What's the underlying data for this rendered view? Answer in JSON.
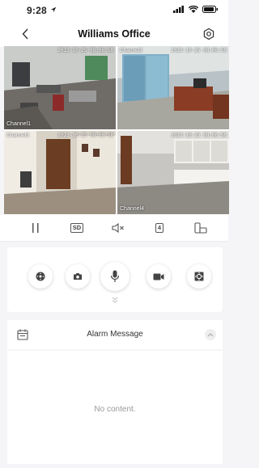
{
  "status_bar": {
    "time": "9:28"
  },
  "nav": {
    "title": "Williams Office"
  },
  "cameras": [
    {
      "label": "Channel1",
      "timestamp": "2023-10-25 08:06:58"
    },
    {
      "label": "Channel2",
      "timestamp": "2023-10-25 08:06:58"
    },
    {
      "label": "Channel3",
      "timestamp": "2023-10-25 08:06:58"
    },
    {
      "label": "Channel4",
      "timestamp": "2023-10-25 08:06:58"
    }
  ],
  "toolbar": {
    "quality_label": "SD",
    "split_label": "4"
  },
  "alarm": {
    "title": "Alarm Message",
    "empty_text": "No content."
  },
  "colors": {
    "selected_border": "#e21d1d",
    "background": "#f5f5f7"
  },
  "icons": [
    "navigation-arrow-icon",
    "signal-icon",
    "wifi-icon",
    "battery-icon",
    "back-icon",
    "settings-icon",
    "pause-icon",
    "mute-icon",
    "orientation-icon",
    "ptz-icon",
    "snapshot-icon",
    "microphone-icon",
    "record-icon",
    "zoom-icon",
    "chevron-down-icon",
    "calendar-icon",
    "chevron-up-icon"
  ]
}
